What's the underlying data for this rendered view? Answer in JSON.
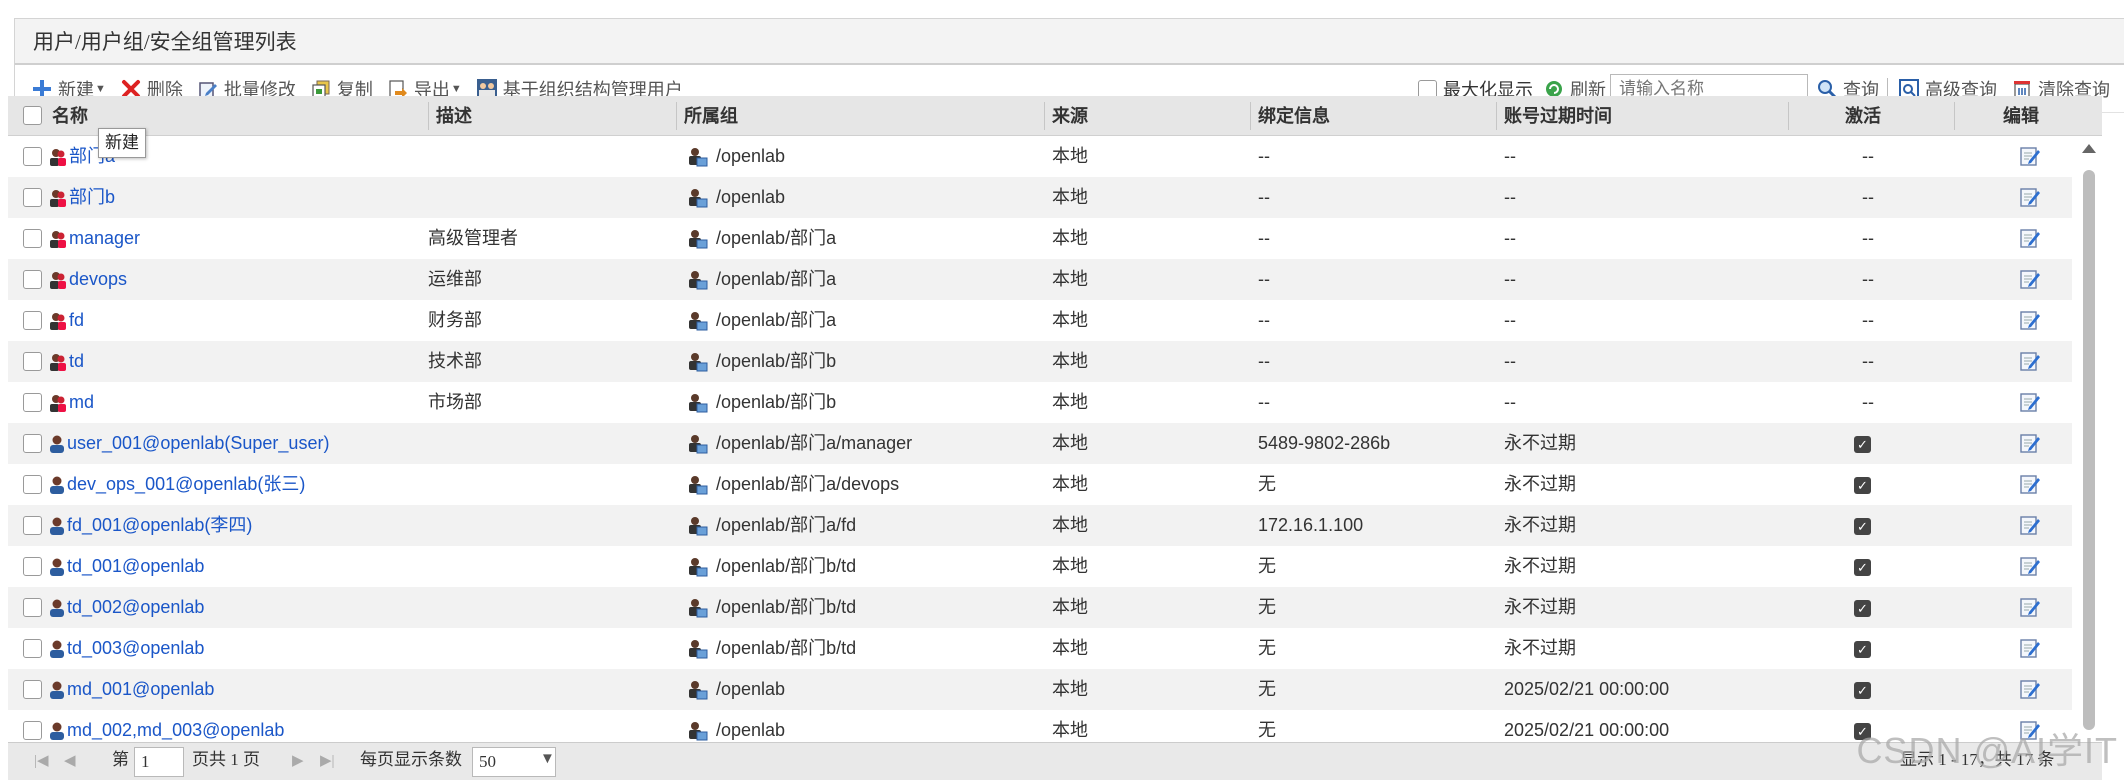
{
  "header": {
    "title": "用户/用户组/安全组管理列表"
  },
  "toolbar": {
    "new_label": "新建",
    "delete_label": "删除",
    "batch_edit_label": "批量修改",
    "copy_label": "复制",
    "export_label": "导出",
    "org_manage_label": "基于组织结构管理用户",
    "maximize_label": "最大化显示",
    "refresh_label": "刷新",
    "search_placeholder": "请输入名称",
    "query_label": "查询",
    "advanced_query_label": "高级查询",
    "clear_query_label": "清除查询"
  },
  "tooltip": {
    "text": "新建"
  },
  "columns": {
    "name": "名称",
    "desc": "描述",
    "group": "所属组",
    "source": "来源",
    "binding": "绑定信息",
    "expire": "账号过期时间",
    "active": "激活",
    "edit": "编辑"
  },
  "rows": [
    {
      "type": "group",
      "name": "部门a",
      "desc": "",
      "group": "/openlab",
      "source": "本地",
      "binding": "--",
      "expire": "--",
      "active": "--"
    },
    {
      "type": "group",
      "name": "部门b",
      "desc": "",
      "group": "/openlab",
      "source": "本地",
      "binding": "--",
      "expire": "--",
      "active": "--"
    },
    {
      "type": "group",
      "name": "manager",
      "desc": "高级管理者",
      "group": "/openlab/部门a",
      "source": "本地",
      "binding": "--",
      "expire": "--",
      "active": "--"
    },
    {
      "type": "group",
      "name": "devops",
      "desc": "运维部",
      "group": "/openlab/部门a",
      "source": "本地",
      "binding": "--",
      "expire": "--",
      "active": "--"
    },
    {
      "type": "group",
      "name": "fd",
      "desc": "财务部",
      "group": "/openlab/部门a",
      "source": "本地",
      "binding": "--",
      "expire": "--",
      "active": "--"
    },
    {
      "type": "group",
      "name": "td",
      "desc": "技术部",
      "group": "/openlab/部门b",
      "source": "本地",
      "binding": "--",
      "expire": "--",
      "active": "--"
    },
    {
      "type": "group",
      "name": "md",
      "desc": "市场部",
      "group": "/openlab/部门b",
      "source": "本地",
      "binding": "--",
      "expire": "--",
      "active": "--"
    },
    {
      "type": "user",
      "name": "user_001@openlab(Super_user)",
      "desc": "",
      "group": "/openlab/部门a/manager",
      "source": "本地",
      "binding": "5489-9802-286b",
      "expire": "永不过期",
      "active": "checked"
    },
    {
      "type": "user",
      "name": "dev_ops_001@openlab(张三)",
      "desc": "",
      "group": "/openlab/部门a/devops",
      "source": "本地",
      "binding": "无",
      "expire": "永不过期",
      "active": "checked"
    },
    {
      "type": "user",
      "name": "fd_001@openlab(李四)",
      "desc": "",
      "group": "/openlab/部门a/fd",
      "source": "本地",
      "binding": "172.16.1.100",
      "expire": "永不过期",
      "active": "checked"
    },
    {
      "type": "user",
      "name": "td_001@openlab",
      "desc": "",
      "group": "/openlab/部门b/td",
      "source": "本地",
      "binding": "无",
      "expire": "永不过期",
      "active": "checked"
    },
    {
      "type": "user",
      "name": "td_002@openlab",
      "desc": "",
      "group": "/openlab/部门b/td",
      "source": "本地",
      "binding": "无",
      "expire": "永不过期",
      "active": "checked"
    },
    {
      "type": "user",
      "name": "td_003@openlab",
      "desc": "",
      "group": "/openlab/部门b/td",
      "source": "本地",
      "binding": "无",
      "expire": "永不过期",
      "active": "checked"
    },
    {
      "type": "user",
      "name": "md_001@openlab",
      "desc": "",
      "group": "/openlab",
      "source": "本地",
      "binding": "无",
      "expire": "2025/02/21 00:00:00",
      "active": "checked"
    },
    {
      "type": "user",
      "name": "md_002,md_003@openlab",
      "desc": "",
      "group": "/openlab",
      "source": "本地",
      "binding": "无",
      "expire": "2025/02/21 00:00:00",
      "active": "checked"
    }
  ],
  "pager": {
    "page_prefix": "第",
    "page_value": "1",
    "page_total": "页共 1 页",
    "per_page_label": "每页显示条数",
    "per_page_value": "50",
    "summary": "显示 1 - 17，共 17 条"
  },
  "watermark": "CSDN @AI学IT",
  "colors": {
    "link": "#1a56c8",
    "header_bg": "#e6e6e6",
    "even_row": "#f2f2f2"
  }
}
